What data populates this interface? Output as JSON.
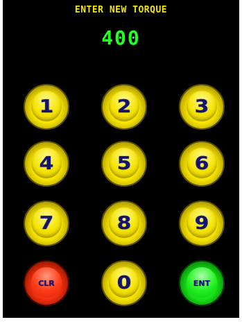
{
  "header": {
    "prompt": "ENTER NEW TORQUE",
    "value": "400"
  },
  "colors": {
    "background": "#000000",
    "prompt_text": "#f2e600",
    "value_text": "#22ff22",
    "key_yellow": "#f6e400",
    "key_clear": "#f03010",
    "key_enter": "#18e018",
    "key_label": "#14146e"
  },
  "keypad": {
    "k1": "1",
    "k2": "2",
    "k3": "3",
    "k4": "4",
    "k5": "5",
    "k6": "6",
    "k7": "7",
    "k8": "8",
    "k9": "9",
    "clear": "CLR",
    "k0": "0",
    "enter": "ENT"
  }
}
